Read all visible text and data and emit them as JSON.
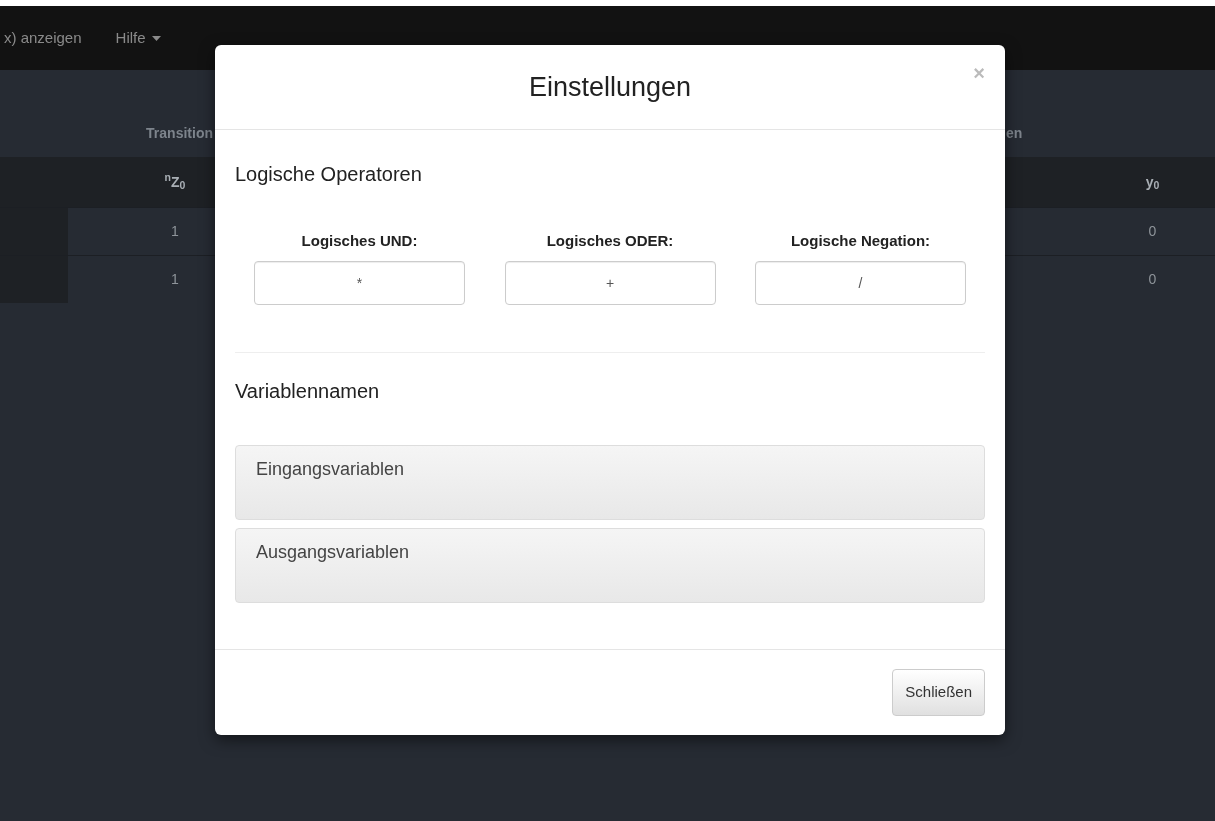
{
  "navbar": {
    "items": [
      {
        "label": "x) anzeigen",
        "dropdown": false
      },
      {
        "label": "Hilfe",
        "dropdown": true
      }
    ]
  },
  "table": {
    "group_headers": [
      "Transition",
      "en"
    ],
    "columns": [
      "$^{n}$Z$_{0}$",
      "y$_{0}$"
    ],
    "rows": [
      [
        "1",
        "0"
      ],
      [
        "1",
        "0"
      ]
    ]
  },
  "modal": {
    "title": "Einstellungen",
    "close": "×",
    "sections": [
      {
        "heading": "Logische Operatoren",
        "operators": [
          {
            "label": "Logisches UND:",
            "value": "*"
          },
          {
            "label": "Logisches ODER:",
            "value": "+"
          },
          {
            "label": "Logische Negation:",
            "value": "/"
          }
        ]
      },
      {
        "heading": "Variablennamen",
        "panels": [
          {
            "title": "Eingangsvariablen"
          },
          {
            "title": "Ausgangsvariablen"
          }
        ]
      }
    ],
    "buttons": [
      "Schließen"
    ]
  }
}
